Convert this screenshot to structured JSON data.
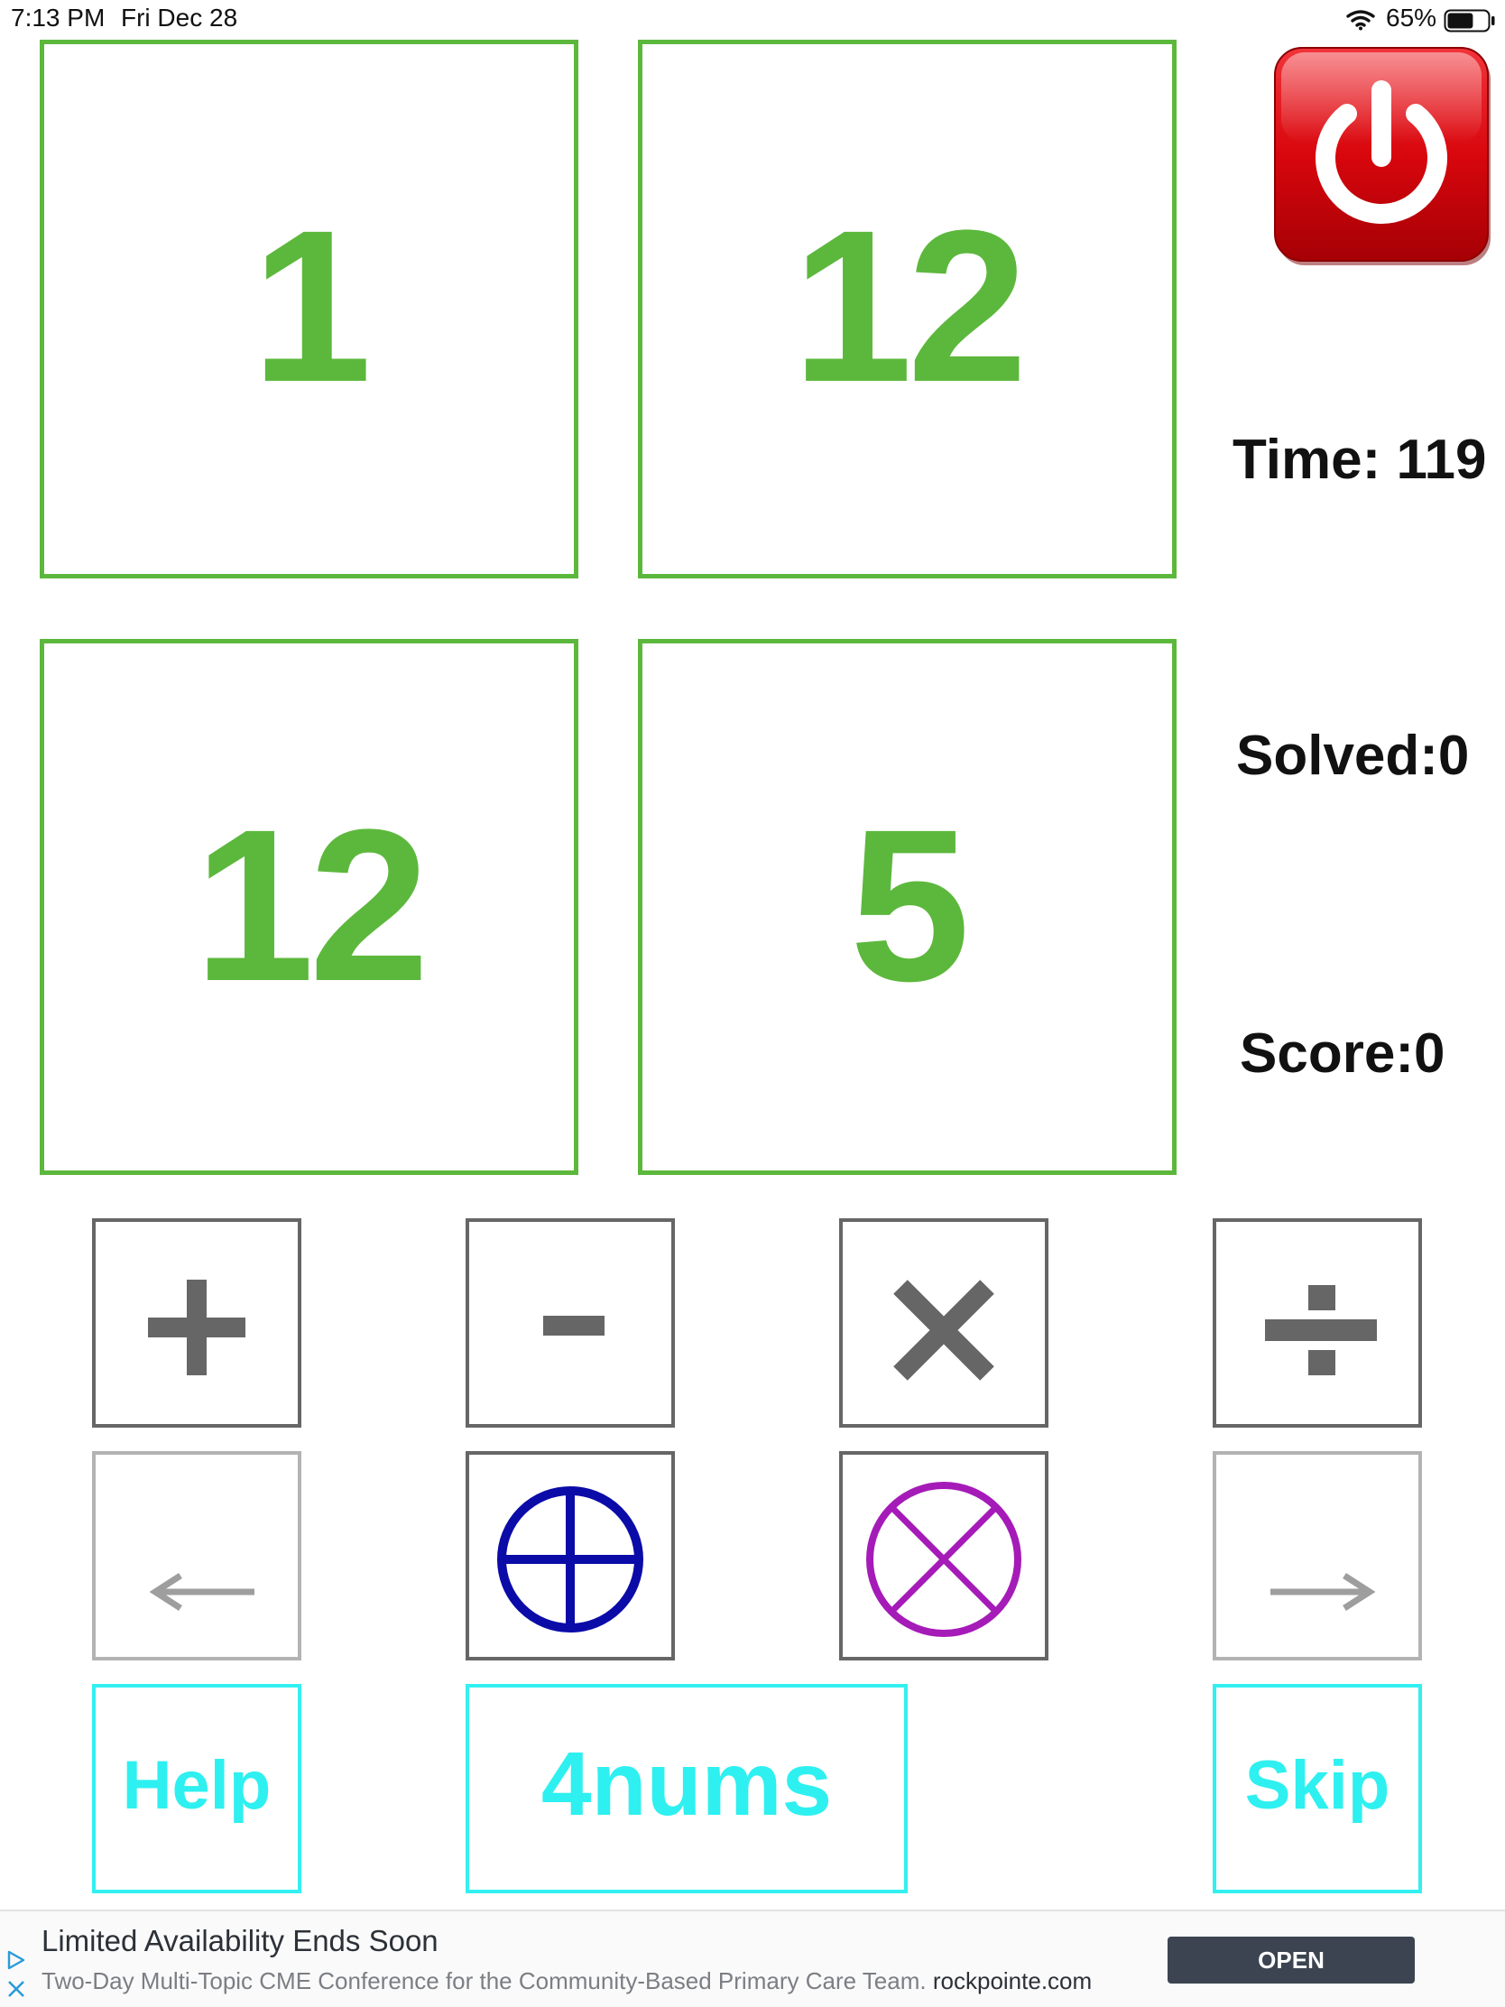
{
  "status_bar": {
    "time": "7:13 PM",
    "date": "Fri Dec 28",
    "battery": "65%",
    "battery_level": 0.65
  },
  "tiles": [
    {
      "value": "1"
    },
    {
      "value": "12"
    },
    {
      "value": "12"
    },
    {
      "value": "5"
    }
  ],
  "stats": {
    "time": "Time: 119",
    "solved": "Solved:0",
    "score": "Score:0"
  },
  "icons": {
    "power": "power-icon",
    "plus": "plus-icon",
    "minus": "minus-icon",
    "multiply": "multiply-icon",
    "divide": "divide-icon",
    "undo": "left-arrow-icon",
    "add_target": "circled-plus-icon",
    "clear": "circled-times-icon",
    "redo": "right-arrow-icon"
  },
  "buttons": {
    "help": "Help",
    "title": "4nums",
    "skip": "Skip"
  },
  "ad": {
    "title": "Limited Availability Ends Soon",
    "description": "Two-Day Multi-Topic CME Conference for the Community-Based Primary Care Team.",
    "domain": "rockpointe.com",
    "cta": "OPEN"
  },
  "colors": {
    "tile_green": "#5cb83c",
    "cyan": "#2ef0f0",
    "operator_gray": "#666666",
    "circle_plus_blue": "#0b0ba8",
    "circle_times_purple": "#a51bb8",
    "power_red": "#d8070d"
  }
}
